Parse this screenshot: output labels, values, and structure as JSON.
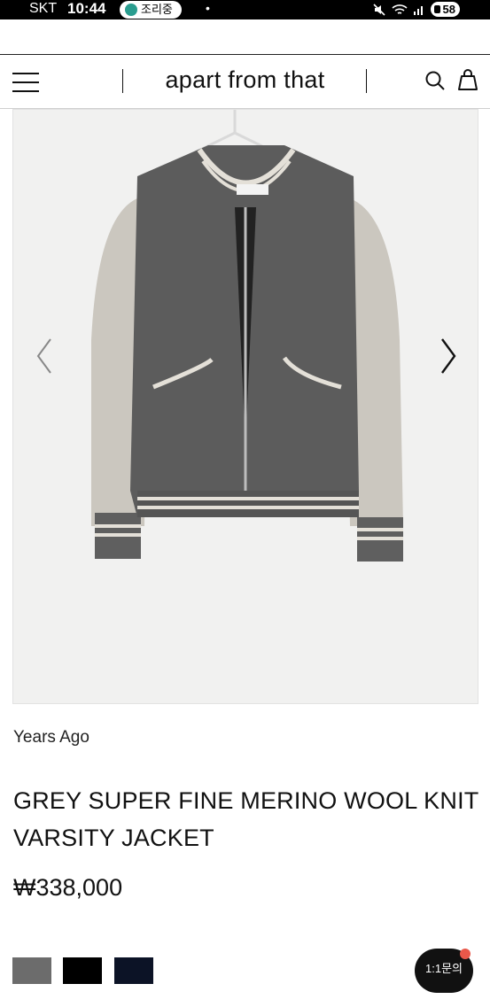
{
  "status_bar": {
    "carrier": "SKT",
    "time": "10:44",
    "notification": "조리중",
    "dot": "•",
    "battery": "58",
    "icons": [
      "mute-icon",
      "wifi-icon",
      "signal-icon"
    ]
  },
  "header": {
    "brand": "apart from that",
    "icons": [
      "menu-icon",
      "search-icon",
      "shopping-bag-icon"
    ]
  },
  "gallery": {
    "icons": [
      "chevron-left-icon",
      "chevron-right-icon"
    ]
  },
  "product": {
    "brand": "Years Ago",
    "title": "GREY SUPER FINE MERINO WOOL KNIT VARSITY JACKET",
    "price": "₩338,000",
    "swatch_colors": [
      "#6c6c6c",
      "#000000",
      "#0c1326"
    ]
  },
  "chat": {
    "label": "1:1문의"
  }
}
